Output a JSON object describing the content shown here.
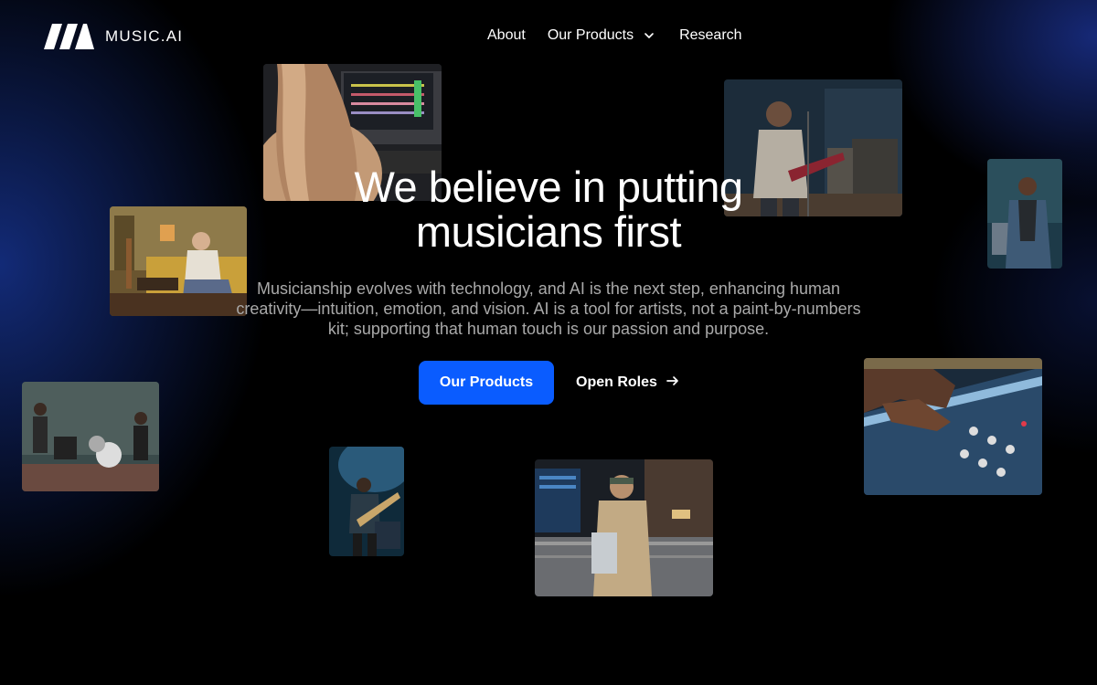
{
  "brand": {
    "name": "MUSIC.AI",
    "logo_icon": "music-ai-logo-icon"
  },
  "nav": {
    "items": [
      {
        "label": "About"
      },
      {
        "label": "Our Products",
        "icon": "chevron-down-icon"
      },
      {
        "label": "Research"
      }
    ]
  },
  "hero": {
    "title_line1": "We believe in putting",
    "title_line2": "musicians first",
    "subtitle": "Musicianship evolves with technology, and AI is the next step, enhancing human creativity—intuition, emotion, and vision. AI is a tool for artists, not a paint-by-numbers kit; supporting that human touch is our passion and purpose.",
    "primary_cta": "Our Products",
    "secondary_cta": "Open Roles",
    "secondary_cta_icon": "arrow-right-icon"
  },
  "colors": {
    "background": "#000000",
    "accent": "#0a5cff",
    "subtitle": "#a9a9a9",
    "glow": "#1a3a9c"
  }
}
